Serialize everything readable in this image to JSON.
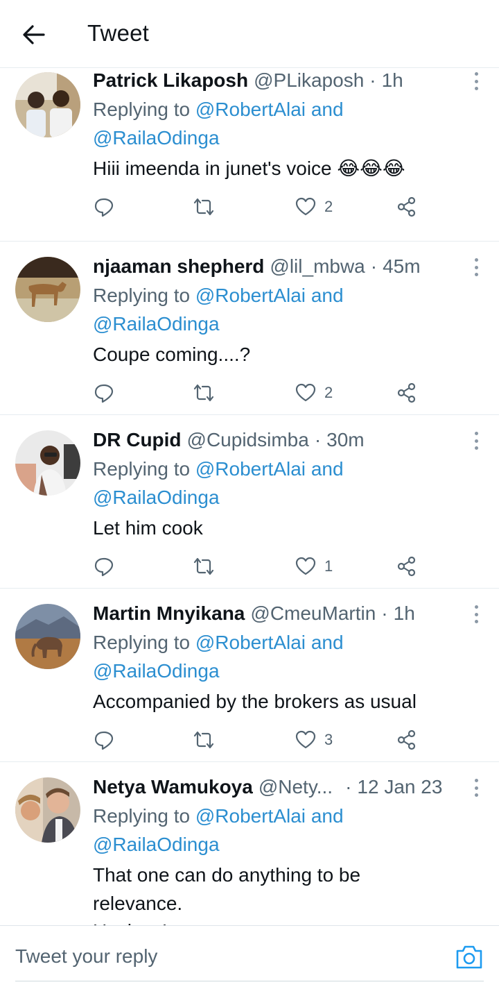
{
  "header": {
    "title": "Tweet"
  },
  "tweets": [
    {
      "name": "Patrick Likaposh",
      "handle": "@PLikaposh",
      "time": "1h",
      "replying_prefix": "Replying to",
      "mention1": "@RobertAlai",
      "and": "and",
      "mention2": "@RailaOdinga",
      "text": "Hiii imeenda in junet's voice 😂😂😂",
      "likes": "2"
    },
    {
      "name": "njaaman shepherd",
      "handle": "@lil_mbwa",
      "time": "45m",
      "replying_prefix": "Replying to",
      "mention1": "@RobertAlai",
      "and": "and",
      "mention2": "@RailaOdinga",
      "text": "Coupe coming....?",
      "likes": "2"
    },
    {
      "name": "DR Cupid",
      "handle": "@Cupidsimba",
      "time": "30m",
      "replying_prefix": "Replying to",
      "mention1": "@RobertAlai",
      "and": "and",
      "mention2": "@RailaOdinga",
      "text": "Let him cook",
      "likes": "1"
    },
    {
      "name": "Martin Mnyikana",
      "handle": "@CmeuMartin",
      "time": "1h",
      "replying_prefix": "Replying to",
      "mention1": "@RobertAlai",
      "and": "and",
      "mention2": "@RailaOdinga",
      "text": "Accompanied by the brokers as usual",
      "likes": "3"
    },
    {
      "name": "Netya Wamukoya",
      "handle": "@Nety...",
      "time": "12 Jan 23",
      "replying_prefix": "Replying to",
      "mention1": "@RobertAlai",
      "and": "and",
      "mention2": "@RailaOdinga",
      "text_lines": [
        "That one can do anything to be",
        "relevance.",
        "Useless!"
      ]
    }
  ],
  "composer": {
    "placeholder": "Tweet your reply"
  },
  "icons": {
    "back": "arrow-left-icon",
    "more": "more-vertical-icon",
    "reply": "reply-icon",
    "retweet": "retweet-icon",
    "like": "heart-icon",
    "share": "share-icon",
    "camera": "camera-icon"
  },
  "colors": {
    "mention": "#2b8ed0",
    "secondary_text": "#536471",
    "icon": "#536471"
  }
}
